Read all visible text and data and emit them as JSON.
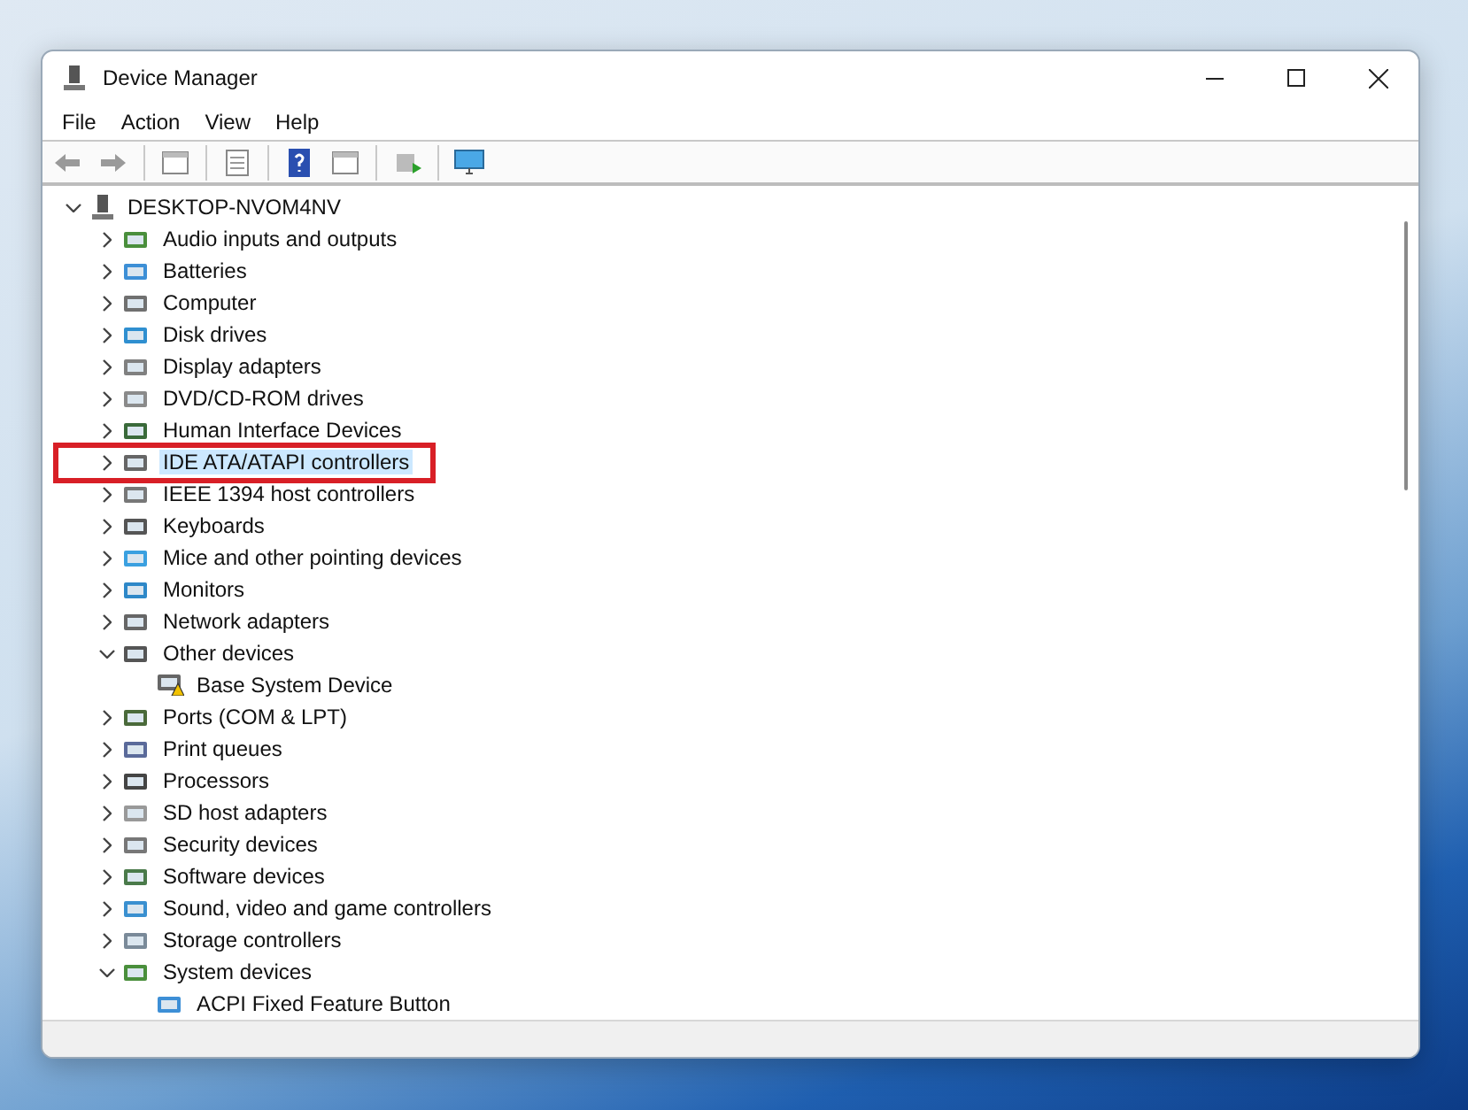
{
  "window": {
    "title": "Device Manager"
  },
  "menu": [
    "File",
    "Action",
    "View",
    "Help"
  ],
  "tree": {
    "label": "DESKTOP-NVOM4NV",
    "expanded": true,
    "selected": false,
    "children": [
      {
        "label": "Audio inputs and outputs",
        "expanded": false,
        "selected": false
      },
      {
        "label": "Batteries",
        "expanded": false,
        "selected": false
      },
      {
        "label": "Computer",
        "expanded": false,
        "selected": false
      },
      {
        "label": "Disk drives",
        "expanded": false,
        "selected": false
      },
      {
        "label": "Display adapters",
        "expanded": false,
        "selected": false
      },
      {
        "label": "DVD/CD-ROM drives",
        "expanded": false,
        "selected": false
      },
      {
        "label": "Human Interface Devices",
        "expanded": false,
        "selected": false
      },
      {
        "label": "IDE ATA/ATAPI controllers",
        "expanded": false,
        "selected": true,
        "highlighted": true
      },
      {
        "label": "IEEE 1394 host controllers",
        "expanded": false,
        "selected": false
      },
      {
        "label": "Keyboards",
        "expanded": false,
        "selected": false
      },
      {
        "label": "Mice and other pointing devices",
        "expanded": false,
        "selected": false
      },
      {
        "label": "Monitors",
        "expanded": false,
        "selected": false
      },
      {
        "label": "Network adapters",
        "expanded": false,
        "selected": false
      },
      {
        "label": "Other devices",
        "expanded": true,
        "selected": false,
        "children": [
          {
            "label": "Base System Device",
            "selected": false,
            "warning": true
          }
        ]
      },
      {
        "label": "Ports (COM & LPT)",
        "expanded": false,
        "selected": false
      },
      {
        "label": "Print queues",
        "expanded": false,
        "selected": false
      },
      {
        "label": "Processors",
        "expanded": false,
        "selected": false
      },
      {
        "label": "SD host adapters",
        "expanded": false,
        "selected": false
      },
      {
        "label": "Security devices",
        "expanded": false,
        "selected": false
      },
      {
        "label": "Software devices",
        "expanded": false,
        "selected": false
      },
      {
        "label": "Sound, video and game controllers",
        "expanded": false,
        "selected": false
      },
      {
        "label": "Storage controllers",
        "expanded": false,
        "selected": false
      },
      {
        "label": "System devices",
        "expanded": true,
        "selected": false,
        "children": [
          {
            "label": "ACPI Fixed Feature Button",
            "selected": false
          }
        ]
      }
    ]
  }
}
